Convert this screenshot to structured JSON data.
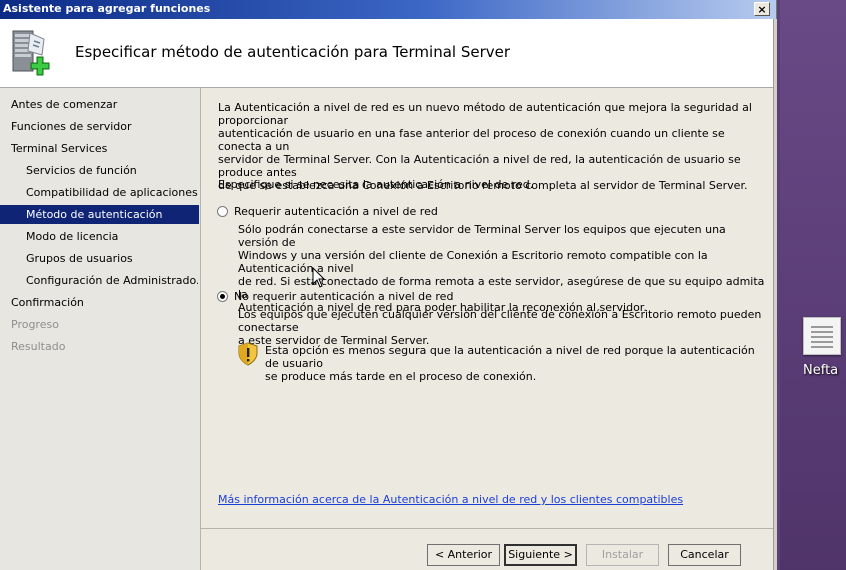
{
  "window": {
    "title": "Asistente para agregar funciones",
    "close_glyph": "×"
  },
  "header": {
    "title": "Especificar método de autenticación para Terminal Server",
    "icon": "server-add-icon"
  },
  "sidebar": {
    "items": [
      {
        "label": "Antes de comenzar",
        "level": "top",
        "state": "normal"
      },
      {
        "label": "Funciones de servidor",
        "level": "top",
        "state": "normal"
      },
      {
        "label": "Terminal Services",
        "level": "top",
        "state": "normal"
      },
      {
        "label": "Servicios de función",
        "level": "sub",
        "state": "normal"
      },
      {
        "label": "Compatibilidad de aplicaciones",
        "level": "sub",
        "state": "normal"
      },
      {
        "label": "Método de autenticación",
        "level": "sub",
        "state": "selected"
      },
      {
        "label": "Modo de licencia",
        "level": "sub",
        "state": "normal"
      },
      {
        "label": "Grupos de usuarios",
        "level": "sub",
        "state": "normal"
      },
      {
        "label": "Configuración de Administrado...",
        "level": "sub",
        "state": "normal"
      },
      {
        "label": "Confirmación",
        "level": "top",
        "state": "normal"
      },
      {
        "label": "Progreso",
        "level": "top",
        "state": "disabled"
      },
      {
        "label": "Resultado",
        "level": "top",
        "state": "disabled"
      }
    ]
  },
  "main": {
    "intro_lines": [
      "La Autenticación a nivel de red es un nuevo método de autenticación que mejora la seguridad al proporcionar",
      "autenticación de usuario en una fase anterior del proceso de conexión cuando un cliente se conecta a un",
      "servidor de Terminal Server. Con la Autenticación a nivel de red, la autenticación de usuario se produce antes",
      "de que se establezca una Conexión a Escritorio remoto completa al servidor de Terminal Server."
    ],
    "prompt": "Especifique si se necesita la autenticación a nivel de red.",
    "option_require": {
      "label": "Requerir autenticación a nivel de red",
      "selected": false,
      "desc_lines": [
        "Sólo podrán conectarse a este servidor de Terminal Server los equipos que ejecuten una versión de",
        "Windows y una versión del cliente de Conexión a Escritorio remoto compatible con la Autenticación a nivel",
        "de red. Si está conectado de forma remota a este servidor, asegúrese de que su equipo admita la",
        "Autenticación a nivel de red para poder habilitar la reconexión al servidor."
      ]
    },
    "option_no_require": {
      "label": "No requerir autenticación a nivel de red",
      "selected": true,
      "desc_lines": [
        "Los equipos que ejecuten cualquier versión del cliente de conexión a Escritorio remoto pueden conectarse",
        "a este servidor de Terminal Server."
      ],
      "warning_lines": [
        "Esta opción es menos segura que la autenticación a nivel de red porque la autenticación de usuario",
        "se produce más tarde en el proceso de conexión."
      ],
      "warning_icon": "shield-warning-icon"
    },
    "more_info_link": "Más información acerca de la Autenticación a nivel de red y los clientes compatibles"
  },
  "footer": {
    "back": "< Anterior",
    "next": "Siguiente >",
    "install": "Instalar",
    "cancel": "Cancelar"
  },
  "desktop": {
    "icon_label": "Nefta",
    "icon": "document-icon"
  },
  "colors": {
    "selection": "#0f2474",
    "link": "#1c3ed8",
    "desktop": "#5b3d77"
  }
}
